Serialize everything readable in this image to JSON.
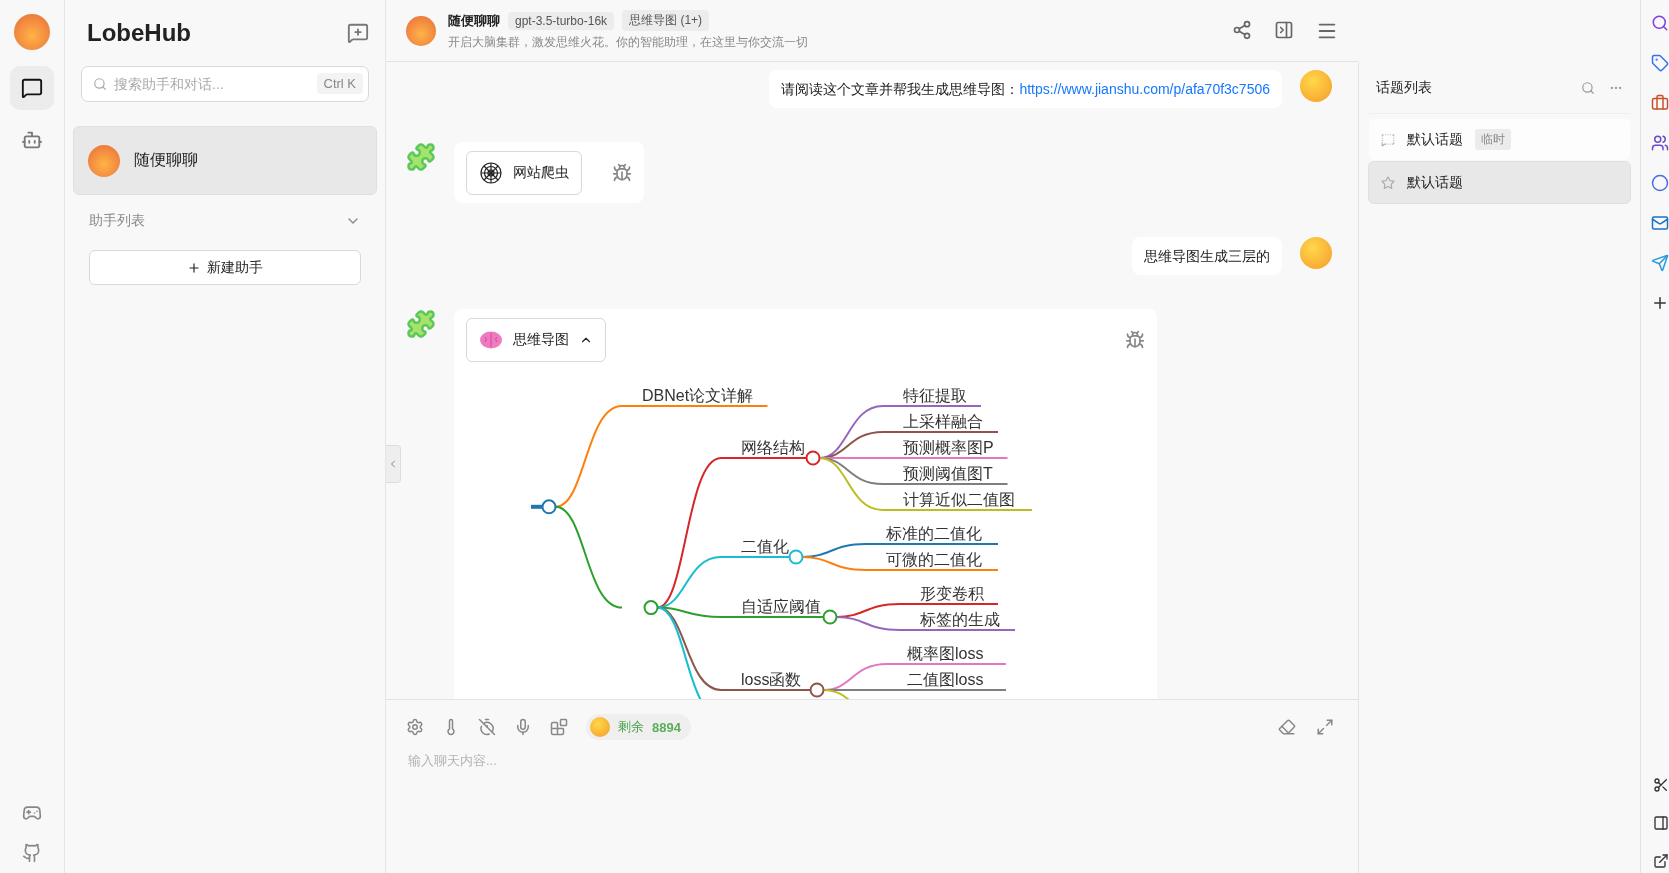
{
  "rail": {
    "items": [
      {
        "kind": "chat",
        "selected": true
      },
      {
        "kind": "bot",
        "selected": false
      }
    ]
  },
  "sidebar": {
    "brand": "LobeHub",
    "search": {
      "placeholder": "搜索助手和对话...",
      "shortcut": "Ctrl K"
    },
    "sessions": [
      {
        "title": "随便聊聊",
        "selected": true
      }
    ],
    "section": {
      "title": "助手列表",
      "expanded": true
    },
    "new_button": "新建助手"
  },
  "header": {
    "title": "随便聊聊",
    "model": "gpt-3.5-turbo-16k",
    "plugins": "思维导图 (1+)",
    "description": "开启大脑集群，激发思维火花。你的智能助理，在这里与你交流一切"
  },
  "messages": [
    {
      "kind": "user",
      "text": "请阅读这个文章并帮我生成思维导图：",
      "link": "https://www.jianshu.com/p/afa70f3c7506"
    },
    {
      "kind": "plugin",
      "plugin": "网站爬虫",
      "expanded": false
    },
    {
      "kind": "user",
      "text": "思维导图生成三层的"
    },
    {
      "kind": "plugin",
      "plugin": "思维导图",
      "expanded": true,
      "mindmap": {
        "color": "#1f77b4",
        "children": [
          {
            "label": "DBNet论文详解",
            "color": "#ff7f0e"
          },
          {
            "color": "#2ca02c",
            "children": [
              {
                "label": "网络结构",
                "color": "#d62728",
                "children": [
                  {
                    "label": "特征提取",
                    "color": "#9467bd"
                  },
                  {
                    "label": "上采样融合",
                    "color": "#8c564b"
                  },
                  {
                    "label": "预测概率图P",
                    "color": "#e377c2"
                  },
                  {
                    "label": "预测阈值图T",
                    "color": "#7f7f7f"
                  },
                  {
                    "label": "计算近似二值图",
                    "color": "#bcbd22"
                  }
                ]
              },
              {
                "label": "二值化",
                "color": "#17becf",
                "children": [
                  {
                    "label": "标准的二值化",
                    "color": "#1f77b4"
                  },
                  {
                    "label": "可微的二值化",
                    "color": "#ff7f0e"
                  }
                ]
              },
              {
                "label": "自适应阈值",
                "color": "#2ca02c",
                "children": [
                  {
                    "label": "形变卷积",
                    "color": "#d62728"
                  },
                  {
                    "label": "标签的生成",
                    "color": "#9467bd"
                  }
                ]
              },
              {
                "label": "loss函数",
                "color": "#8c564b",
                "children": [
                  {
                    "label": "概率图loss",
                    "color": "#e377c2"
                  },
                  {
                    "label": "二值图loss",
                    "color": "#7f7f7f"
                  },
                  {
                    "color": "#bcbd22"
                  }
                ]
              },
              {
                "color": "#17becf"
              }
            ]
          }
        ]
      }
    }
  ],
  "input": {
    "token_label": "剩余",
    "token_count": "8894",
    "placeholder": "输入聊天内容..."
  },
  "topics": {
    "title": "话题列表",
    "items": [
      {
        "kind": "temp",
        "title": "默认话题",
        "tag": "临时",
        "selected": false
      },
      {
        "kind": "starred",
        "title": "默认话题",
        "selected": true
      }
    ]
  }
}
